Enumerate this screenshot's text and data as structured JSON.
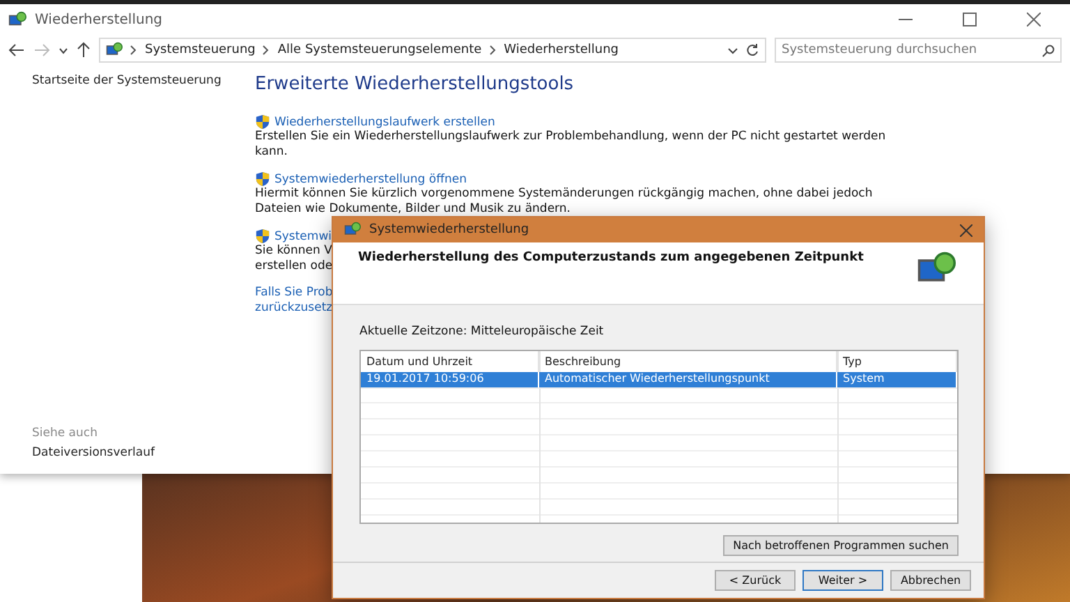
{
  "window": {
    "title": "Wiederherstellung"
  },
  "address_bar": {
    "breadcrumbs": [
      "Systemsteuerung",
      "Alle Systemsteuerungselemente",
      "Wiederherstellung"
    ],
    "search_placeholder": "Systemsteuerung durchsuchen"
  },
  "sidebar": {
    "home_link": "Startseite der Systemsteuerung",
    "see_also_label": "Siehe auch",
    "see_also_links": [
      "Dateiversionsverlauf"
    ]
  },
  "content": {
    "heading": "Erweiterte Wiederherstellungstools",
    "tasks": [
      {
        "link": "Wiederherstellungslaufwerk erstellen",
        "lines": [
          "Erstellen Sie ein Wiederherstellungslaufwerk zur Problembehandlung, wenn der PC nicht gestartet werden",
          "kann."
        ]
      },
      {
        "link": "Systemwiederherstellung öffnen",
        "lines": [
          "Hiermit können Sie kürzlich vorgenommene Systemänderungen rückgängig machen, ohne dabei jedoch",
          "Dateien wie Dokumente, Bilder und Musik zu ändern."
        ]
      },
      {
        "link": "Systemwi",
        "lines": [
          "Sie können V",
          "erstellen ode"
        ]
      }
    ],
    "footer_link_lines": [
      "Falls Sie Prob",
      "zurückzusetz"
    ]
  },
  "dialog": {
    "title": "Systemwiederherstellung",
    "header": "Wiederherstellung des Computerzustands zum angegebenen Zeitpunkt",
    "timezone": "Aktuelle Zeitzone: Mitteleuropäische Zeit",
    "columns": [
      "Datum und Uhrzeit",
      "Beschreibung",
      "Typ"
    ],
    "rows": [
      {
        "date": "19.01.2017 10:59:06",
        "description": "Automatischer Wiederherstellungspunkt",
        "type": "System",
        "selected": true
      }
    ],
    "scan_button": "Nach betroffenen Programmen suchen",
    "buttons": [
      {
        "label": "< Zurück",
        "default": false
      },
      {
        "label": "Weiter >",
        "default": true
      },
      {
        "label": "Abbrechen",
        "default": false
      }
    ]
  }
}
